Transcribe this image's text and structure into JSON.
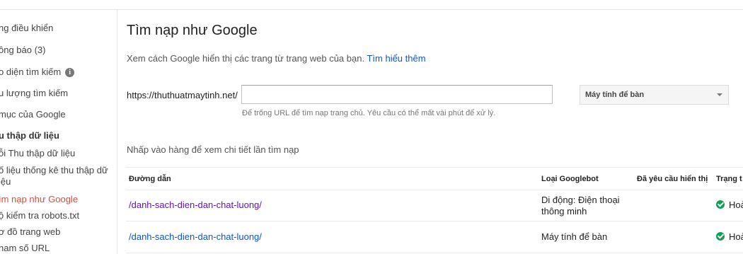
{
  "sidebar": {
    "items": [
      {
        "label": "ng điều khiển"
      },
      {
        "label": "ông báo (3)"
      },
      {
        "label": "o diện tìm kiếm"
      },
      {
        "label": "u lượng tìm kiếm"
      },
      {
        "label": "mục của Google"
      },
      {
        "label": "u thập dữ liệu"
      },
      {
        "label": "ỗi Thu thập dữ liệu"
      },
      {
        "label": "ố liệu thống kê thu thập dữ"
      },
      {
        "label": "iệu"
      },
      {
        "label": "ìm nạp như Google"
      },
      {
        "label": "ộ kiểm tra robots.txt"
      },
      {
        "label": "ơ đồ trang web"
      },
      {
        "label": "ham số URL"
      }
    ]
  },
  "main": {
    "title": "Tìm nạp như Google",
    "description": "Xem cách Google hiển thị các trang từ trang web của bạn.",
    "learn_more": "Tìm hiểu thêm",
    "url_prefix": "https://thuthuatmaytinh.net/",
    "url_value": "",
    "hint": "Để trống URL để tìm nạp trang chủ. Yêu cầu có thể mất vài phút để xử lý.",
    "device_selected": "Máy tính để bàn",
    "instruction": "Nhấp vào hàng để xem chi tiết lần tìm nạp"
  },
  "table": {
    "headers": {
      "path": "Đường dẫn",
      "googlebot": "Loại Googlebot",
      "requested": "Đã yêu cầu hiển thị",
      "status": "Trạng t"
    },
    "rows": [
      {
        "path": "/danh-sach-dien-dan-chat-luong/",
        "googlebot_line1": "Di động: Điện thoại",
        "googlebot_line2": "thông minh",
        "status": "Hoà"
      },
      {
        "path": "/danh-sach-dien-dan-chat-luong/",
        "googlebot_line1": "Máy tính để bàn",
        "googlebot_line2": "",
        "status": "Hoà"
      }
    ]
  },
  "colors": {
    "link": "#1155cc",
    "visited_link": "#6611cc",
    "active_nav": "#dd4b39",
    "success": "#0f9d58"
  },
  "icons": [
    "info-icon",
    "chevron-down-icon",
    "check-circle-icon"
  ]
}
